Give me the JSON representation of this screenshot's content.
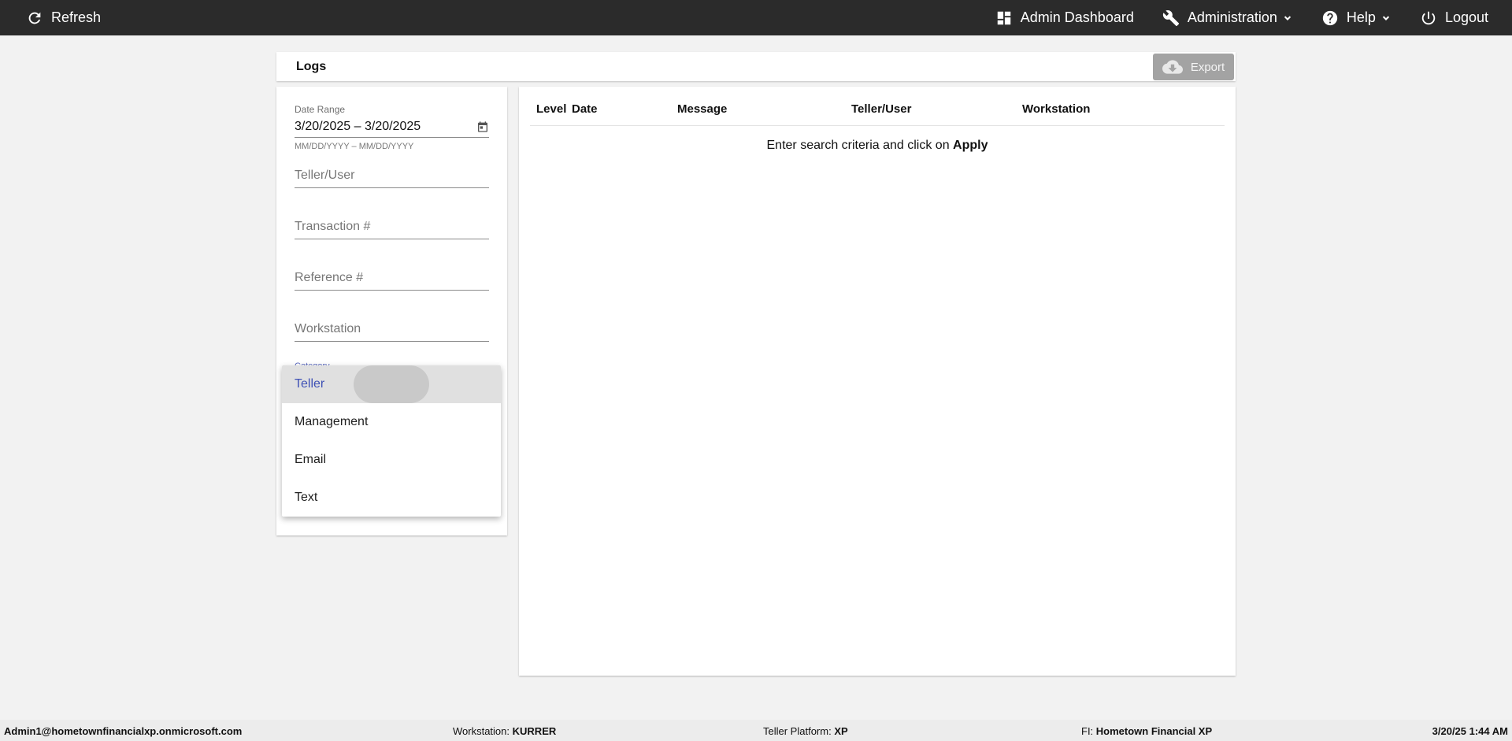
{
  "topbar": {
    "refresh_label": "Refresh",
    "admin_dashboard_label": "Admin Dashboard",
    "administration_label": "Administration",
    "help_label": "Help",
    "logout_label": "Logout"
  },
  "logs": {
    "title": "Logs",
    "export_label": "Export"
  },
  "filters": {
    "date_range_label": "Date Range",
    "date_range_value": "3/20/2025 – 3/20/2025",
    "date_range_hint": "MM/DD/YYYY – MM/DD/YYYY",
    "teller_user_placeholder": "Teller/User",
    "transaction_placeholder": "Transaction #",
    "reference_placeholder": "Reference #",
    "workstation_placeholder": "Workstation",
    "category_label": "Category"
  },
  "category_dropdown": {
    "options": [
      "Teller",
      "Management",
      "Email",
      "Text"
    ],
    "selected": "Teller"
  },
  "results": {
    "columns": [
      "Level",
      "Date",
      "Message",
      "Teller/User",
      "Workstation"
    ],
    "empty_prefix": "Enter search criteria and click on ",
    "empty_action": "Apply"
  },
  "statusbar": {
    "user": "Admin1@hometownfinancialxp.onmicrosoft.com",
    "workstation_label": "Workstation:",
    "workstation_value": "KURRER",
    "platform_label": "Teller Platform:",
    "platform_value": "XP",
    "fi_label": "FI:",
    "fi_value": "Hometown Financial XP",
    "datetime": "3/20/25 1:44 AM"
  }
}
